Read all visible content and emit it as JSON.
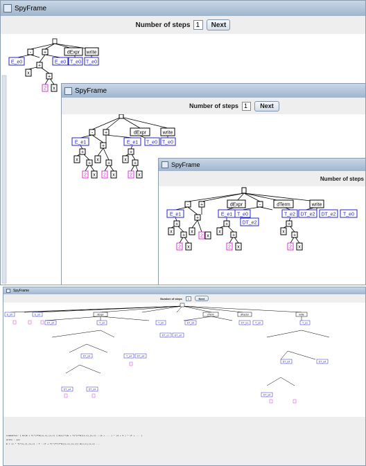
{
  "window_top": {
    "title": "SpyFrame",
    "steps_label": "Number of steps",
    "steps_value": "1",
    "next_label": "Next"
  },
  "window_mid": {
    "title": "SpyFrame",
    "steps_label": "Number of steps",
    "steps_value": "1",
    "next_label": "Next"
  },
  "window_inner": {
    "title": "SpyFrame",
    "steps_label": "Number of steps"
  },
  "window_bottom": {
    "title": "SpyFrame",
    "steps_label": "Number of steps",
    "steps_value": "1",
    "next_label": "Next",
    "status_lines": [
      "Loadative: [ E=(E + T)*(T*E)(x,x),(x,x) ] E(e)*=(E + T)*(T*E)(x,x),(x,x) ; (1 + ... ) * (1 + 2 ) * (T + ... )",
      "write : yes",
      "E = (x * T)*(x,x),(x,x) ;  T : (T + T)*(T*(T*E)(x,x),(x,x)) E(x,x),(x,x) ..."
    ]
  },
  "colors": {
    "ident": "#2222cc",
    "number": "#dd33dd",
    "edge": "#000000",
    "node_border": "#000000",
    "title_gradient_top": "#c9d7e6"
  },
  "tree_top": {
    "root": "[]",
    "children": [
      "-",
      "+",
      "dExpr",
      "write"
    ],
    "leaves": [
      "E_e0",
      "x",
      "+",
      "E_e0",
      "T_e0",
      "T_e0",
      "x",
      "2",
      "x"
    ]
  },
  "tree_mid": {
    "root": "[]",
    "children": [
      "-",
      "+",
      "dExpr",
      "write"
    ],
    "leaves": [
      "E_e1",
      "E_e1",
      "T_e0",
      "T_e0",
      "x",
      "x",
      "x",
      "x",
      "2",
      "x",
      "2",
      "x",
      "2",
      "x"
    ]
  },
  "tree_inner": {
    "root": "[]",
    "children": [
      "-",
      "+",
      "-",
      "dExpr",
      "dTerm",
      "write"
    ],
    "leaves": [
      "E_e1",
      "E_e1",
      "T_e0",
      "DT_e2",
      "T_e2",
      "DT_e2",
      "DT_e2",
      "T_e0",
      "x",
      "x",
      "2",
      "x",
      "x",
      "x",
      "2",
      "x",
      "2",
      "x"
    ]
  },
  "tree_bottom": {
    "labels_ident": [
      "E_e0",
      "E_e0",
      "DT_e0",
      "T_e0",
      "T_e0",
      "DT_e0",
      "DT_e1",
      "T_e1",
      "DT_e1",
      "DT_e0",
      "T_e0",
      "DT_e4",
      "T_e4",
      "DT_e4",
      "DT_e4",
      "DT_e4",
      "DT_e4",
      "DT_e4",
      "DT_e4"
    ],
    "labels_op": [
      "dExpr",
      "dTerm",
      "dExpr",
      "dFactor",
      "write",
      "dExprBox"
    ]
  }
}
